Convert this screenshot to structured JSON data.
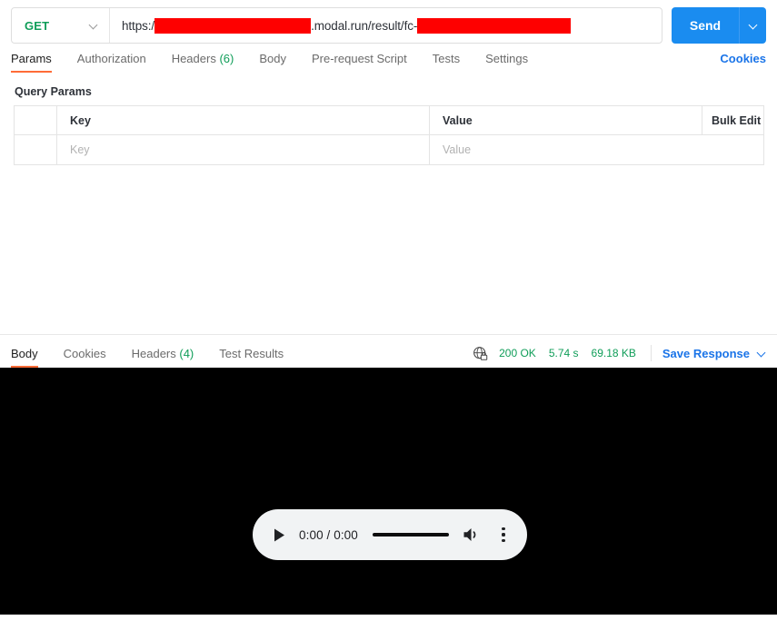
{
  "request": {
    "method": "GET",
    "method_caret_icon": "chevron-down-icon",
    "url_prefix": "https:/",
    "url_middle": ".modal.run/result/fc-",
    "url_redaction_1": "",
    "url_redaction_2": "",
    "send_label": "Send",
    "send_caret_icon": "chevron-down-icon",
    "tabs": [
      {
        "label": "Params",
        "count": "",
        "active": true
      },
      {
        "label": "Authorization",
        "count": "",
        "active": false
      },
      {
        "label": "Headers",
        "count": "(6)",
        "active": false
      },
      {
        "label": "Body",
        "count": "",
        "active": false
      },
      {
        "label": "Pre-request Script",
        "count": "",
        "active": false
      },
      {
        "label": "Tests",
        "count": "",
        "active": false
      },
      {
        "label": "Settings",
        "count": "",
        "active": false
      }
    ],
    "cookies_link": "Cookies"
  },
  "query_params": {
    "title": "Query Params",
    "columns": {
      "check": "",
      "key": "Key",
      "value": "Value",
      "bulk_edit": "Bulk Edit"
    },
    "rows": [
      {
        "check": "",
        "key_placeholder": "Key",
        "value_placeholder": "Value",
        "bulk": ""
      }
    ]
  },
  "response": {
    "tabs": [
      {
        "label": "Body",
        "count": "",
        "active": true
      },
      {
        "label": "Cookies",
        "count": "",
        "active": false
      },
      {
        "label": "Headers",
        "count": "(4)",
        "active": false
      },
      {
        "label": "Test Results",
        "count": "",
        "active": false
      }
    ],
    "globe_icon": "globe-lock-icon",
    "status": "200 OK",
    "time": "5.74 s",
    "size": "69.18 KB",
    "save_label": "Save Response",
    "save_caret_icon": "chevron-down-icon"
  },
  "media_player": {
    "play_icon": "play-icon",
    "time_display": "0:00 / 0:00",
    "volume_icon": "volume-icon",
    "menu_icon": "kebab-menu-icon"
  },
  "colors": {
    "method_green": "#0f9d58",
    "send_blue": "#1a8cf0",
    "link_blue": "#1a74e8",
    "active_underline": "#ff6c37",
    "redaction_red": "#fe0000",
    "media_background": "#000000",
    "player_background": "#f1f3f4"
  }
}
